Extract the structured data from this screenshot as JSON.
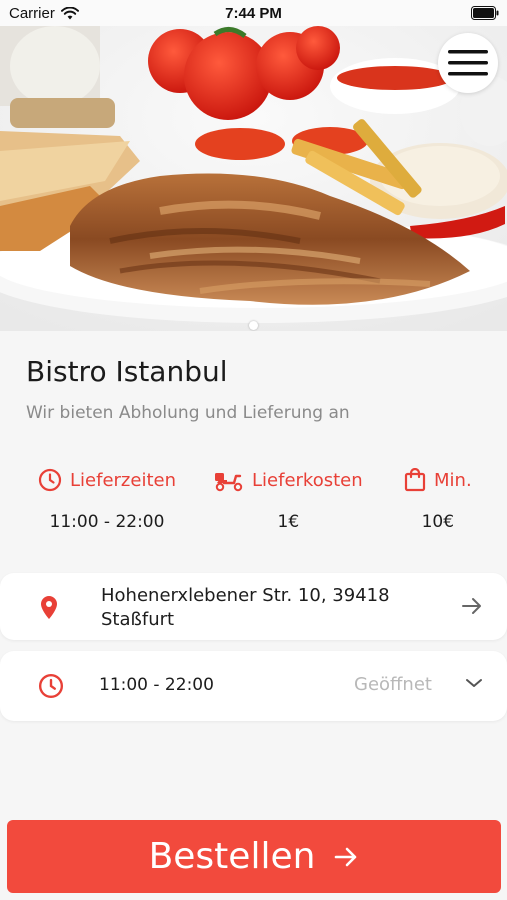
{
  "status_bar": {
    "carrier": "Carrier",
    "time": "7:44 PM"
  },
  "restaurant": {
    "name": "Bistro Istanbul",
    "tagline": "Wir bieten Abholung und Lieferung an"
  },
  "info": [
    {
      "icon": "clock-icon",
      "label": "Lieferzeiten",
      "value": "11:00 - 22:00"
    },
    {
      "icon": "scooter-icon",
      "label": "Lieferkosten",
      "value": "1€"
    },
    {
      "icon": "bag-icon",
      "label": "Min.",
      "value": "10€"
    }
  ],
  "address": {
    "line1": "Hohenerxlebener Str. 10, 39418",
    "line2": "Staßfurt"
  },
  "hours": {
    "time": "11:00 - 22:00",
    "status": "Geöffnet"
  },
  "order_button": {
    "label": "Bestellen"
  },
  "colors": {
    "accent": "#e84037",
    "button": "#f24a3d",
    "muted": "#8a8a8a"
  }
}
